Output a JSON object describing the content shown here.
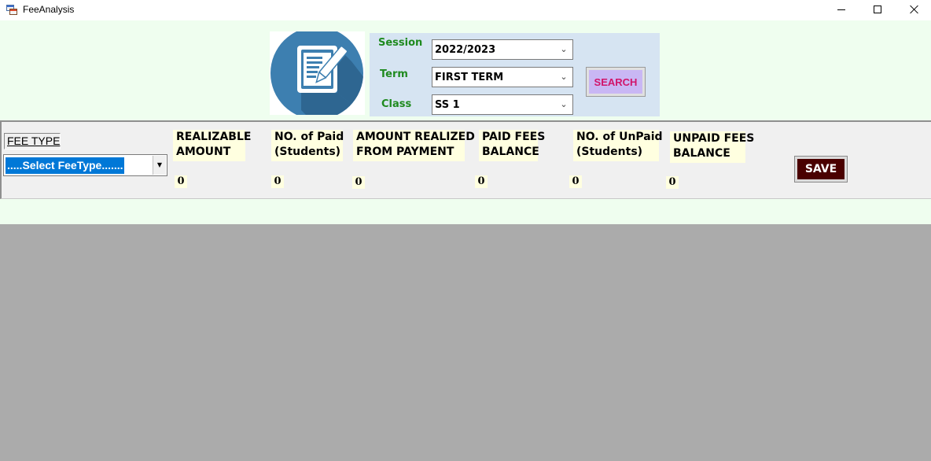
{
  "window": {
    "title": "FeeAnalysis",
    "app_icon": "app-windows-icon",
    "controls": {
      "minimize": "minimize-icon",
      "maximize": "maximize-icon",
      "close": "close-icon"
    }
  },
  "search": {
    "session_label": "Session",
    "session_value": "2022/2023",
    "term_label": "Term",
    "term_value": "FIRST TERM",
    "class_label": "Class",
    "class_value": "SS 1",
    "search_button": "SEARCH",
    "logo_icon": "document-pen-icon"
  },
  "fee": {
    "fee_type_label": "FEE TYPE",
    "fee_type_selected": ".....Select FeeType.......",
    "columns": [
      {
        "line1": "REALIZABLE",
        "line2": "AMOUNT",
        "value": "0"
      },
      {
        "line1": "NO. of Paid",
        "line2": "(Students)",
        "value": "0"
      },
      {
        "line1": "AMOUNT REALIZED",
        "line2": "FROM PAYMENT",
        "value": "0"
      },
      {
        "line1": "PAID FEES",
        "line2": "BALANCE",
        "value": "0"
      },
      {
        "line1": "NO. of UnPaid",
        "line2": "(Students)",
        "value": "0"
      },
      {
        "line1": "UNPAID FEES",
        "line2": "BALANCE",
        "value": "0"
      }
    ],
    "save_button": "SAVE"
  },
  "colors": {
    "form_background": "#effeef",
    "search_panel": "#d6e4f2",
    "label_green": "#1f8a1f",
    "search_button_bg": "#c9b7f4",
    "search_button_text": "#d1146a",
    "header_fill": "#ffffe0",
    "save_button_bg": "#4a0000",
    "selection_blue": "#0078d7",
    "content_gray": "#ababab"
  }
}
